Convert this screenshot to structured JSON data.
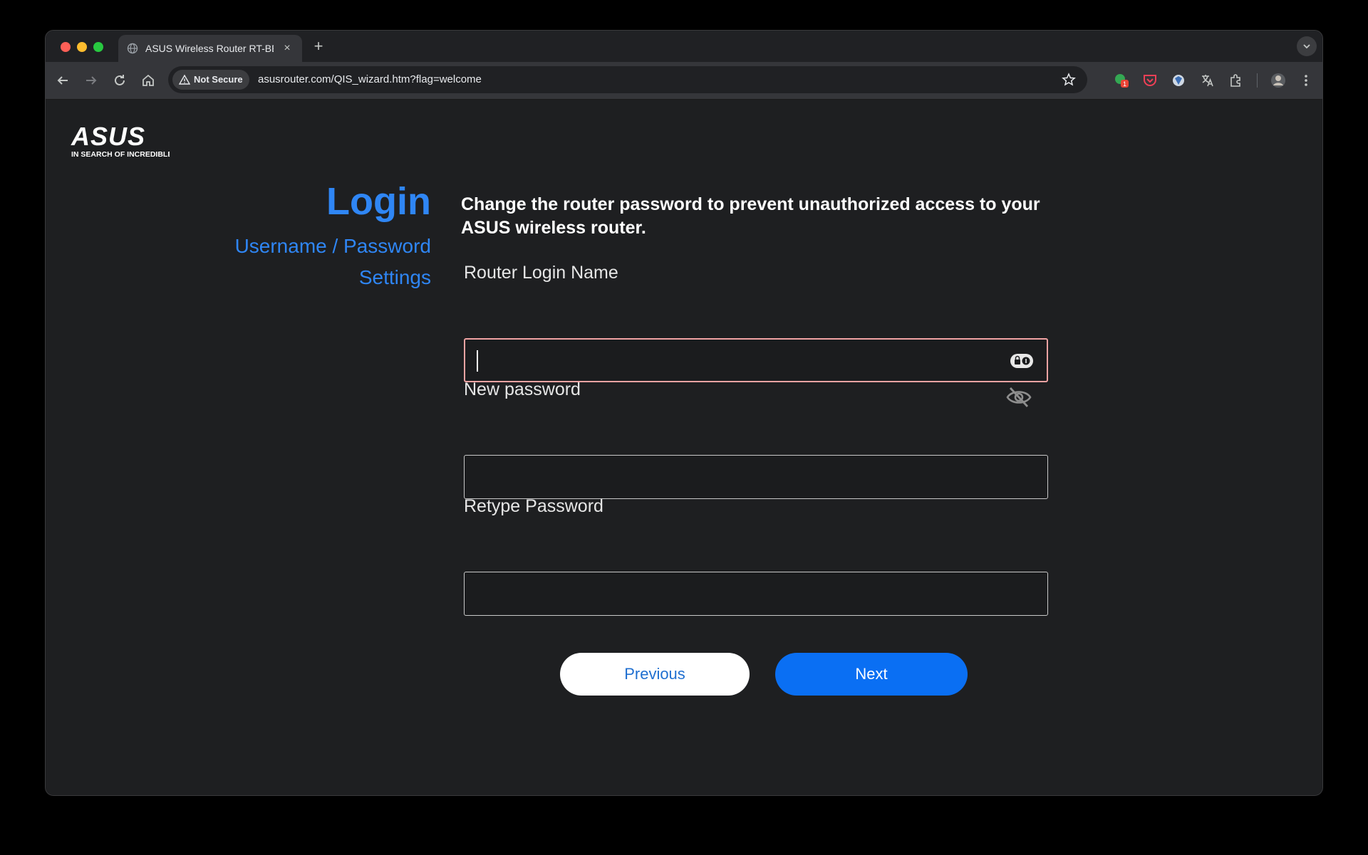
{
  "browser": {
    "tab_title": "ASUS Wireless Router RT-BE",
    "tab_close": "×",
    "new_tab": "+",
    "security_chip": "Not Secure",
    "url": "asusrouter.com/QIS_wizard.htm?flag=welcome",
    "extension_badge": "1"
  },
  "brand": {
    "logo_text": "ASUS",
    "tagline": "IN SEARCH OF INCREDIBLE"
  },
  "steps": {
    "title": "Login",
    "item_1": "Username / Password",
    "item_2": "Settings"
  },
  "form": {
    "description": "Change the router password to prevent unauthorized access to your ASUS wireless router.",
    "login_name_label": "Router Login Name",
    "login_name_value": "",
    "new_password_label": "New password",
    "new_password_value": "",
    "retype_password_label": "Retype Password",
    "retype_password_value": ""
  },
  "buttons": {
    "previous": "Previous",
    "next": "Next"
  },
  "colors": {
    "accent_blue": "#2f86f5",
    "next_button": "#0a6ff3",
    "focus_border": "#f1a3a3"
  }
}
